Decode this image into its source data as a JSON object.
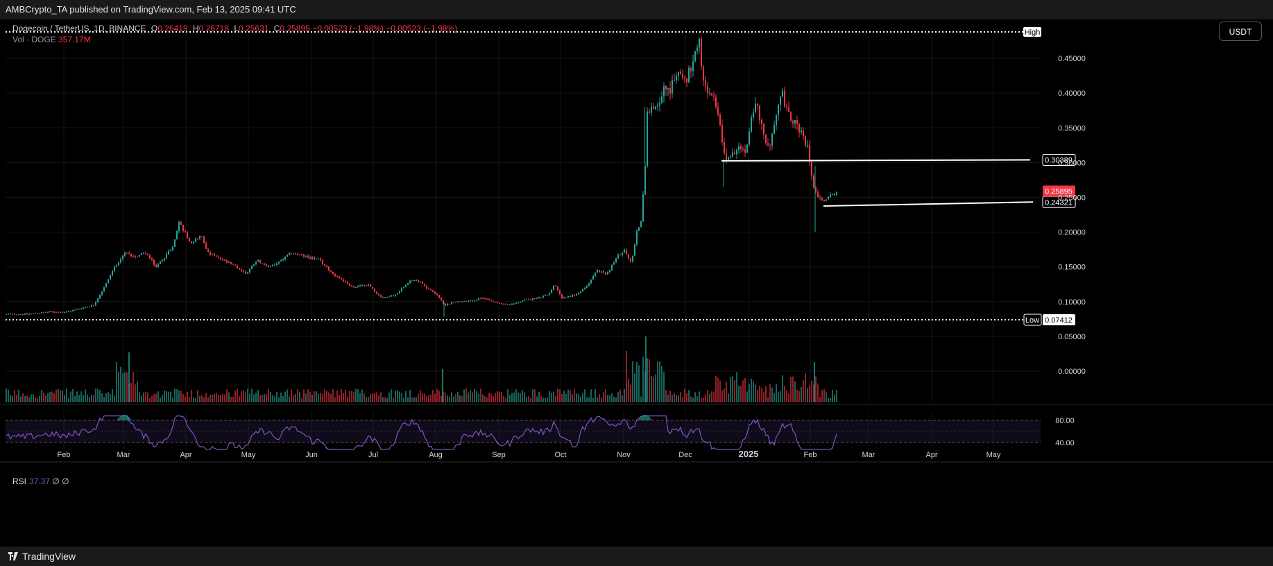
{
  "header": {
    "published": "AMBCrypto_TA published on TradingView.com, Feb 13, 2025 09:41 UTC"
  },
  "legend": {
    "symbol": "Dogecoin / TetherUS, 1D, BINANCE",
    "open_label": "O",
    "open": "0.26419",
    "high_label": "H",
    "high": "0.26718",
    "low_label": "L",
    "low": "0.25631",
    "close_label": "C",
    "close": "0.25895",
    "change": "−0.00523 (−1.98%)",
    "change2": "−0.00523 (−1.98%)",
    "volume_label": "Vol · DOGE",
    "volume": "357.17M",
    "rsi_label": "RSI",
    "rsi_value": "37.37",
    "rsi_extra": "∅ ∅"
  },
  "currency_button": "USDT",
  "footer": {
    "brand": "TradingView"
  },
  "colors": {
    "up": "#26a69a",
    "down": "#f23645",
    "rsi_line": "#7e57c2",
    "rsi_band": "#2a1f4d",
    "grid": "#161616",
    "hline": "#ffffff"
  },
  "chart_data": {
    "type": "candlestick",
    "title": "Dogecoin / TetherUS, 1D, BINANCE",
    "x_range": [
      "2025-01-19",
      "2025-05-28"
    ],
    "x_ticks": [
      "Feb",
      "Mar",
      "Apr",
      "May",
      "Jun",
      "Jul",
      "Aug",
      "Sep",
      "Oct",
      "Nov",
      "Dec",
      "2025",
      "Feb",
      "Mar",
      "Apr",
      "May"
    ],
    "y_range": [
      -0.04,
      0.49
    ],
    "y_ticks": [
      0.45,
      0.4,
      0.35,
      0.3,
      0.25,
      0.2,
      0.15,
      0.1,
      0.05,
      0.0
    ],
    "y_tick_labels": [
      "0.45000",
      "0.40000",
      "0.35000",
      "0.30000",
      "0.25000",
      "0.20000",
      "0.15000",
      "0.10000",
      "0.05000",
      "0.00000"
    ],
    "high_level": {
      "label": "High",
      "value": 0.484
    },
    "low_level": {
      "label": "Low",
      "value": 0.07412,
      "value_label": "0.07412"
    },
    "current_price": {
      "value": 0.25895,
      "label": "0.25895"
    },
    "support_lines": [
      {
        "value_label": "0.30389",
        "y_start": 0.3025,
        "y_end": 0.30389
      },
      {
        "value_label": "0.24321",
        "y_start": 0.2375,
        "y_end": 0.24321
      }
    ],
    "price_path": [
      [
        0,
        0.082
      ],
      [
        40,
        0.082
      ],
      [
        70,
        0.085
      ],
      [
        95,
        0.085
      ],
      [
        115,
        0.09
      ],
      [
        135,
        0.095
      ],
      [
        150,
        0.12
      ],
      [
        165,
        0.15
      ],
      [
        180,
        0.17
      ],
      [
        195,
        0.165
      ],
      [
        210,
        0.17
      ],
      [
        225,
        0.15
      ],
      [
        240,
        0.168
      ],
      [
        250,
        0.18
      ],
      [
        258,
        0.215
      ],
      [
        266,
        0.2
      ],
      [
        275,
        0.185
      ],
      [
        290,
        0.195
      ],
      [
        300,
        0.17
      ],
      [
        320,
        0.16
      ],
      [
        340,
        0.15
      ],
      [
        355,
        0.14
      ],
      [
        370,
        0.16
      ],
      [
        385,
        0.15
      ],
      [
        400,
        0.155
      ],
      [
        420,
        0.17
      ],
      [
        440,
        0.165
      ],
      [
        460,
        0.16
      ],
      [
        480,
        0.14
      ],
      [
        495,
        0.13
      ],
      [
        510,
        0.12
      ],
      [
        530,
        0.125
      ],
      [
        550,
        0.105
      ],
      [
        570,
        0.11
      ],
      [
        590,
        0.13
      ],
      [
        605,
        0.13
      ],
      [
        615,
        0.12
      ],
      [
        630,
        0.11
      ],
      [
        640,
        0.095
      ],
      [
        655,
        0.1
      ],
      [
        675,
        0.1
      ],
      [
        695,
        0.105
      ],
      [
        715,
        0.098
      ],
      [
        735,
        0.095
      ],
      [
        755,
        0.102
      ],
      [
        775,
        0.105
      ],
      [
        790,
        0.11
      ],
      [
        800,
        0.125
      ],
      [
        810,
        0.105
      ],
      [
        830,
        0.11
      ],
      [
        845,
        0.12
      ],
      [
        860,
        0.145
      ],
      [
        875,
        0.14
      ],
      [
        890,
        0.165
      ],
      [
        900,
        0.175
      ],
      [
        910,
        0.155
      ],
      [
        918,
        0.2
      ],
      [
        925,
        0.22
      ],
      [
        930,
        0.3
      ],
      [
        933,
        0.38
      ],
      [
        940,
        0.375
      ],
      [
        950,
        0.39
      ],
      [
        960,
        0.41
      ],
      [
        965,
        0.4
      ],
      [
        975,
        0.43
      ],
      [
        990,
        0.42
      ],
      [
        1000,
        0.45
      ],
      [
        1008,
        0.47
      ],
      [
        1012,
        0.42
      ],
      [
        1020,
        0.4
      ],
      [
        1030,
        0.39
      ],
      [
        1040,
        0.34
      ],
      [
        1045,
        0.305
      ],
      [
        1055,
        0.31
      ],
      [
        1065,
        0.32
      ],
      [
        1075,
        0.315
      ],
      [
        1082,
        0.36
      ],
      [
        1090,
        0.39
      ],
      [
        1100,
        0.34
      ],
      [
        1110,
        0.32
      ],
      [
        1120,
        0.38
      ],
      [
        1128,
        0.4
      ],
      [
        1135,
        0.37
      ],
      [
        1145,
        0.36
      ],
      [
        1155,
        0.34
      ],
      [
        1165,
        0.32
      ],
      [
        1172,
        0.27
      ],
      [
        1178,
        0.255
      ],
      [
        1185,
        0.245
      ],
      [
        1195,
        0.25
      ],
      [
        1205,
        0.259
      ]
    ],
    "rsi": {
      "levels": [
        80.0,
        40.0
      ],
      "level_labels": [
        "80.00",
        "40.00"
      ],
      "overbought": 70,
      "oversold": 30,
      "current": 37.37
    },
    "volume_label": "Vol · DOGE",
    "grid": true
  }
}
